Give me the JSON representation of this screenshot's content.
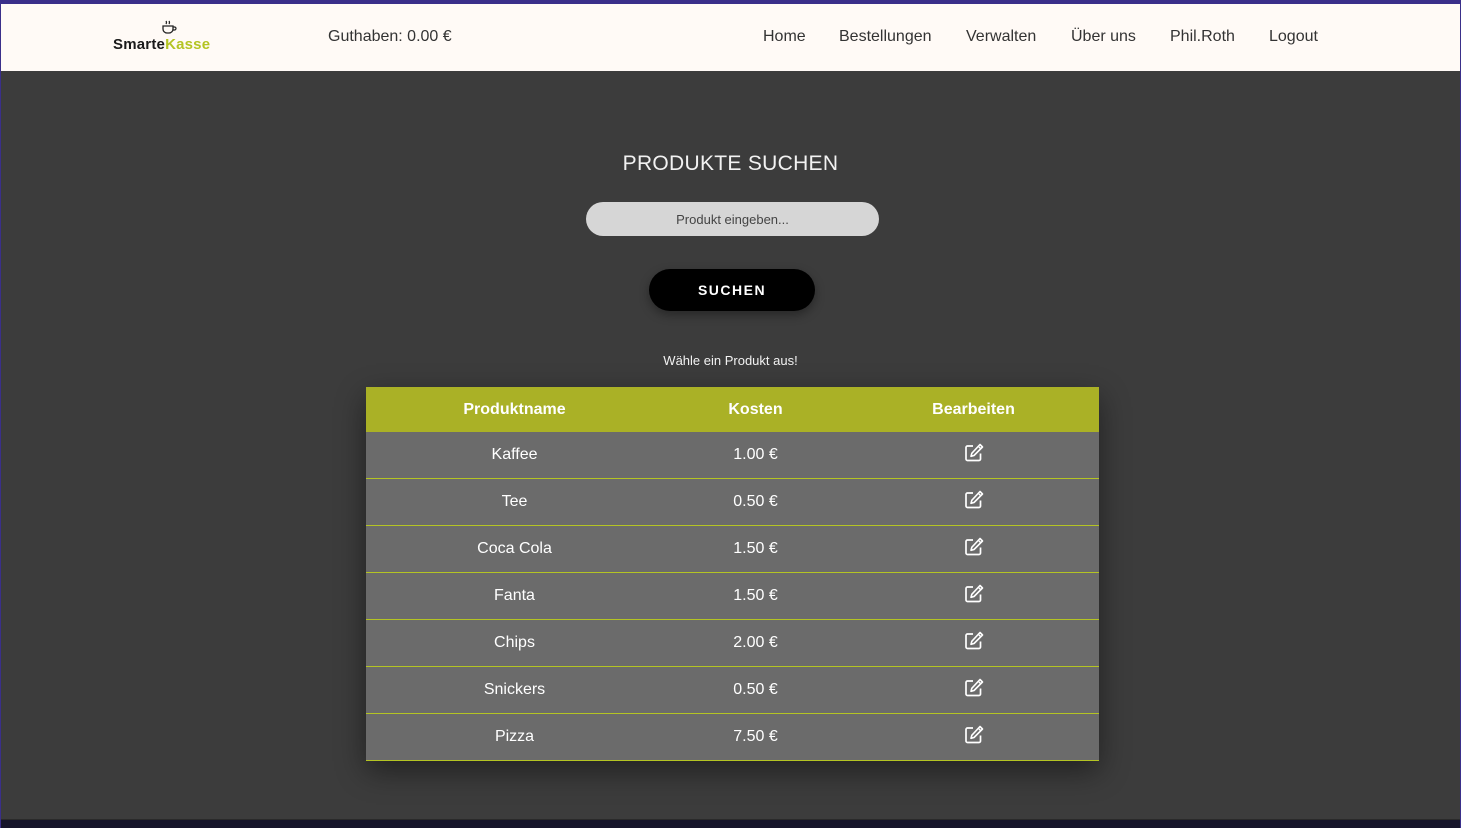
{
  "navbar": {
    "logo": {
      "part1": "Smarte",
      "part2": "Kasse"
    },
    "balance": "Guthaben: 0.00 €",
    "links": [
      "Home",
      "Bestellungen",
      "Verwalten",
      "Über uns",
      "Phil.Roth",
      "Logout"
    ]
  },
  "main": {
    "title": "PRODUKTE SUCHEN",
    "search_placeholder": "Produkt eingeben...",
    "search_button": "SUCHEN",
    "hint": "Wähle ein Produkt aus!"
  },
  "table": {
    "headers": [
      "Produktname",
      "Kosten",
      "Bearbeiten"
    ],
    "rows": [
      {
        "name": "Kaffee",
        "cost": "1.00 €"
      },
      {
        "name": "Tee",
        "cost": "0.50 €"
      },
      {
        "name": "Coca Cola",
        "cost": "1.50 €"
      },
      {
        "name": "Fanta",
        "cost": "1.50 €"
      },
      {
        "name": "Chips",
        "cost": "2.00 €"
      },
      {
        "name": "Snickers",
        "cost": "0.50 €"
      },
      {
        "name": "Pizza",
        "cost": "7.50 €"
      }
    ],
    "edit_icon": "edit-icon"
  },
  "colors": {
    "accent": "#b4c423",
    "header_bg": "#aab126",
    "page_bg": "#3c3c3c",
    "row_bg": "#6b6b6b",
    "navbar_bg": "#fffaf6"
  }
}
